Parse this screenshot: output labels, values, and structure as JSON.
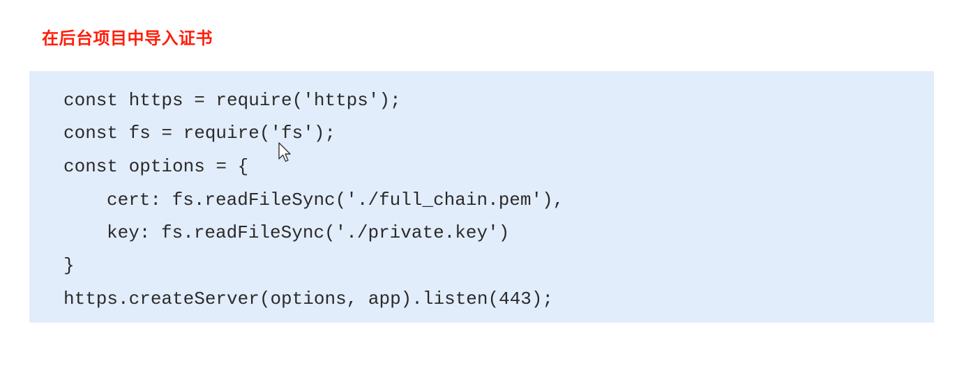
{
  "slide": {
    "heading": "在后台项目中导入证书",
    "heading_color": "#ff1e0a",
    "code_background": "#e2edfb",
    "code_lines": [
      "const https = require('https');",
      "const fs = require('fs');",
      "const options = {",
      "cert: fs.readFileSync('./full_chain.pem'),",
      "key: fs.readFileSync('./private.key')",
      "}",
      "https.createServer(options, app).listen(443);"
    ]
  },
  "cursor": {
    "icon": "mouse-pointer-icon"
  }
}
